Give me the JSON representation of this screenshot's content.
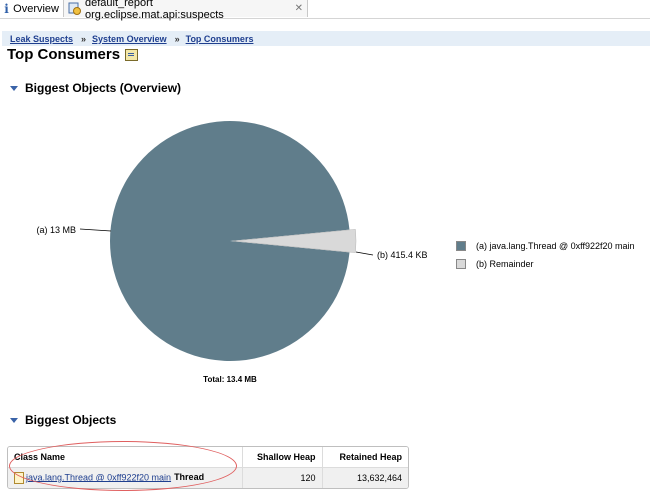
{
  "tabs": [
    {
      "label": "Overview"
    },
    {
      "label": "default_report  org.eclipse.mat.api:suspects"
    }
  ],
  "breadcrumb": [
    {
      "label": "Leak Suspects"
    },
    {
      "label": "System Overview"
    },
    {
      "label": "Top Consumers"
    }
  ],
  "page_title": "Top Consumers",
  "sections": {
    "overview": "Biggest Objects (Overview)",
    "objects": "Biggest Objects"
  },
  "chart_data": {
    "type": "pie",
    "title": "",
    "total_label": "Total: 13.4 MB",
    "slices": [
      {
        "label": "(a)  13 MB",
        "value_mb": 13.0,
        "value_text": "13 MB",
        "legend": "(a)  java.lang.Thread @ 0xff922f20  main",
        "color": "#607d8b"
      },
      {
        "label": "(b)  415.4 KB",
        "value_mb": 0.4057,
        "value_text": "415.4 KB",
        "legend": "(b)  Remainder",
        "color": "#d9d9d9"
      }
    ]
  },
  "table": {
    "columns": [
      "Class Name",
      "Shallow Heap",
      "Retained Heap"
    ],
    "rows": [
      {
        "class_link": "java.lang.Thread @ 0xff922f20 main",
        "extra": "Thread",
        "shallow": "120",
        "retained": "13,632,464"
      }
    ]
  }
}
